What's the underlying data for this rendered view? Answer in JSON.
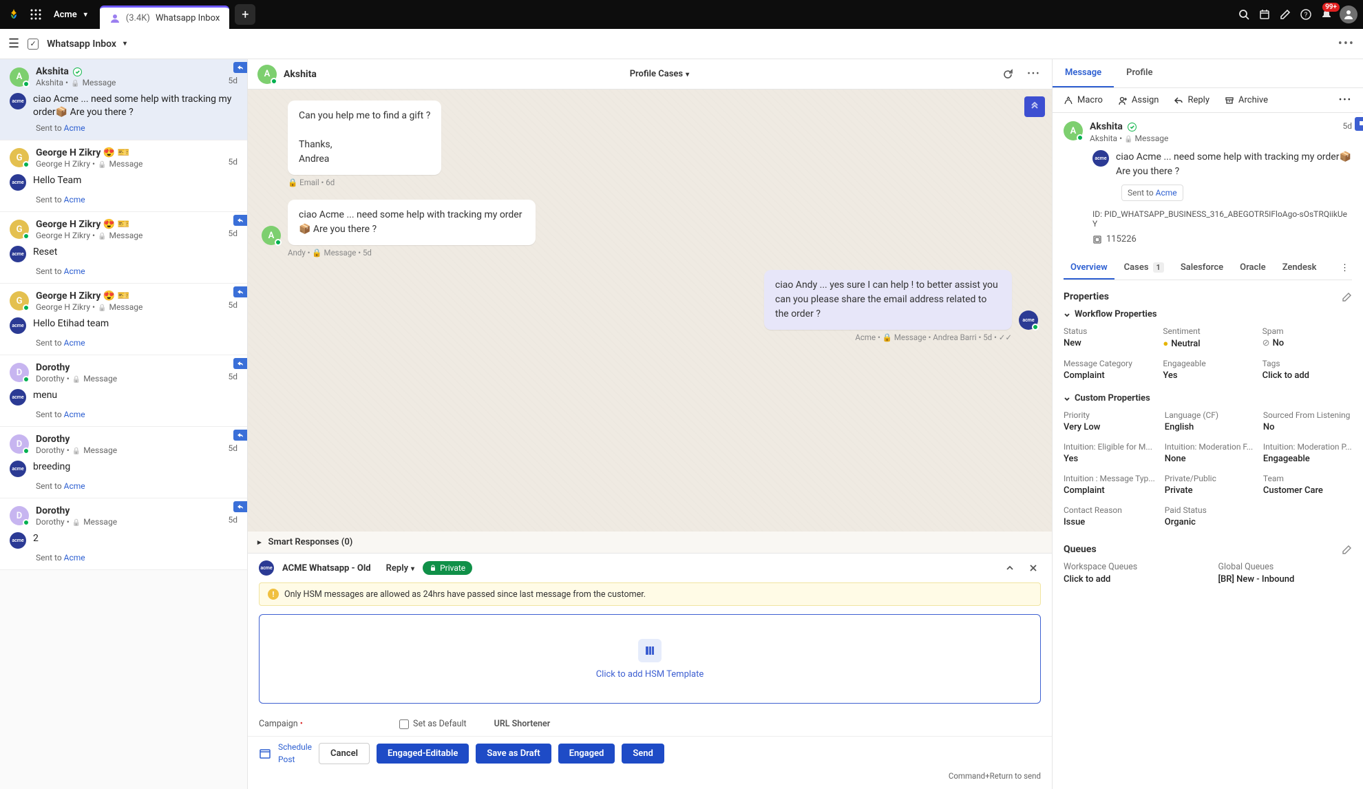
{
  "topbar": {
    "brand": "Acme",
    "tab_count": "(3.4K)",
    "tab_label": "Whatsapp Inbox",
    "notif_badge": "99+"
  },
  "subhead": {
    "title": "Whatsapp Inbox"
  },
  "conversations": [
    {
      "avatar": "A",
      "avcolor": "green",
      "name": "Akshita",
      "verified": true,
      "sub": "Akshita",
      "type": "Message",
      "time": "5d",
      "msg": "ciao Acme ... need some help with tracking my order📦 Are you there ?",
      "sent_to": "Acme",
      "reply": true,
      "selected": true,
      "brand_av": true
    },
    {
      "avatar": "G",
      "avcolor": "gold",
      "name": "George H Zikry 😍 🎫",
      "sub": "George H Zikry",
      "type": "Message",
      "time": "5d",
      "msg": "Hello Team",
      "sent_to": "Acme",
      "brand_av": true
    },
    {
      "avatar": "G",
      "avcolor": "gold",
      "name": "George H Zikry 😍 🎫",
      "sub": "George H Zikry",
      "type": "Message",
      "time": "5d",
      "msg": "Reset",
      "sent_to": "Acme",
      "reply": true,
      "brand_av": true
    },
    {
      "avatar": "G",
      "avcolor": "gold",
      "name": "George H Zikry 😍 🎫",
      "sub": "George H Zikry",
      "type": "Message",
      "time": "5d",
      "msg": "Hello Etihad team",
      "sent_to": "Acme",
      "reply": true,
      "brand_av": true
    },
    {
      "avatar": "D",
      "avcolor": "purple",
      "name": "Dorothy",
      "sub": "Dorothy",
      "type": "Message",
      "time": "5d",
      "msg": "menu",
      "sent_to": "Acme",
      "reply": true,
      "brand_av": true
    },
    {
      "avatar": "D",
      "avcolor": "purple",
      "name": "Dorothy",
      "sub": "Dorothy",
      "type": "Message",
      "time": "5d",
      "msg": "breeding",
      "sent_to": "Acme",
      "reply": true,
      "brand_av": true
    },
    {
      "avatar": "D",
      "avcolor": "purple",
      "name": "Dorothy",
      "sub": "Dorothy",
      "type": "Message",
      "time": "5d",
      "msg": "2",
      "sent_to": "Acme",
      "reply": true,
      "brand_av": true
    }
  ],
  "thread": {
    "name": "Akshita",
    "avatar": "A",
    "center": "Profile Cases",
    "messages": [
      {
        "side": "left",
        "avatar": "",
        "text_lines": [
          "Can you help me to find a gift ?",
          "",
          "Thanks,",
          "Andrea"
        ],
        "meta": "🔒 Email  •  6d"
      },
      {
        "side": "left",
        "avatar": "A",
        "text_lines": [
          "ciao Acme ... need some help with tracking my order 📦 Are you there ?"
        ],
        "meta": "Andy  •  🔒 Message  •  5d"
      },
      {
        "side": "right",
        "avatar": "acme",
        "text_lines": [
          "ciao Andy ... yes sure I can help ! to better assist you can you please share the email address related to the order ?"
        ],
        "meta": "Acme  •  🔒 Message  •  Andrea Barri  •  5d  •  ✓✓"
      }
    ],
    "smart": "Smart Responses (0)"
  },
  "composer": {
    "account": "ACME Whatsapp - Old",
    "reply_label": "Reply",
    "privacy": "Private",
    "hsm_warning": "Only HSM messages are allowed as 24hrs have passed since last message from the customer.",
    "hsm_cta": "Click to add HSM Template",
    "campaign": "Campaign",
    "default": "Set as Default",
    "shortener": "URL Shortener",
    "schedule": "Schedule",
    "post": "Post",
    "cancel": "Cancel",
    "engaged_edit": "Engaged-Editable",
    "draft": "Save as Draft",
    "engaged": "Engaged",
    "send": "Send",
    "hint": "Command+Return to send"
  },
  "detail": {
    "tabs": {
      "message": "Message",
      "profile": "Profile"
    },
    "toolbar": {
      "macro": "Macro",
      "assign": "Assign",
      "reply": "Reply",
      "archive": "Archive"
    },
    "msg": {
      "name": "Akshita",
      "sub": "Akshita",
      "type": "Message",
      "time": "5d",
      "text": "ciao Acme ... need some help with tracking my order📦 Are you there ?",
      "sent_to": "Acme",
      "id_label": "ID:",
      "id": "PID_WHATSAPP_BUSINESS_316_ABEGOTR5IFloAgo-sOsTRQiikUeY",
      "num": "115226"
    },
    "subtabs": {
      "overview": "Overview",
      "cases": "Cases",
      "cases_n": "1",
      "salesforce": "Salesforce",
      "oracle": "Oracle",
      "zendesk": "Zendesk"
    },
    "props_title": "Properties",
    "workflow": "Workflow Properties",
    "custom": "Custom Properties",
    "wf": {
      "status_k": "Status",
      "status_v": "New",
      "sentiment_k": "Sentiment",
      "sentiment_v": "Neutral",
      "spam_k": "Spam",
      "spam_v": "No",
      "cat_k": "Message Category",
      "cat_v": "Complaint",
      "eng_k": "Engageable",
      "eng_v": "Yes",
      "tags_k": "Tags",
      "tags_v": "Click to add"
    },
    "cu": {
      "pri_k": "Priority",
      "pri_v": "Very Low",
      "lang_k": "Language (CF)",
      "lang_v": "English",
      "src_k": "Sourced From Listening",
      "src_v": "No",
      "elig_k": "Intuition: Eligible for M...",
      "elig_v": "Yes",
      "modf_k": "Intuition: Moderation F...",
      "modf_v": "None",
      "modp_k": "Intuition: Moderation P...",
      "modp_v": "Engageable",
      "mtype_k": "Intuition : Message Typ...",
      "mtype_v": "Complaint",
      "priv_k": "Private/Public",
      "priv_v": "Private",
      "team_k": "Team",
      "team_v": "Customer Care",
      "reason_k": "Contact Reason",
      "reason_v": "Issue",
      "paid_k": "Paid Status",
      "paid_v": "Organic"
    },
    "queues": {
      "title": "Queues",
      "ws_k": "Workspace Queues",
      "ws_v": "Click to add",
      "gl_k": "Global Queues",
      "gl_v": "[BR] New - Inbound"
    }
  }
}
